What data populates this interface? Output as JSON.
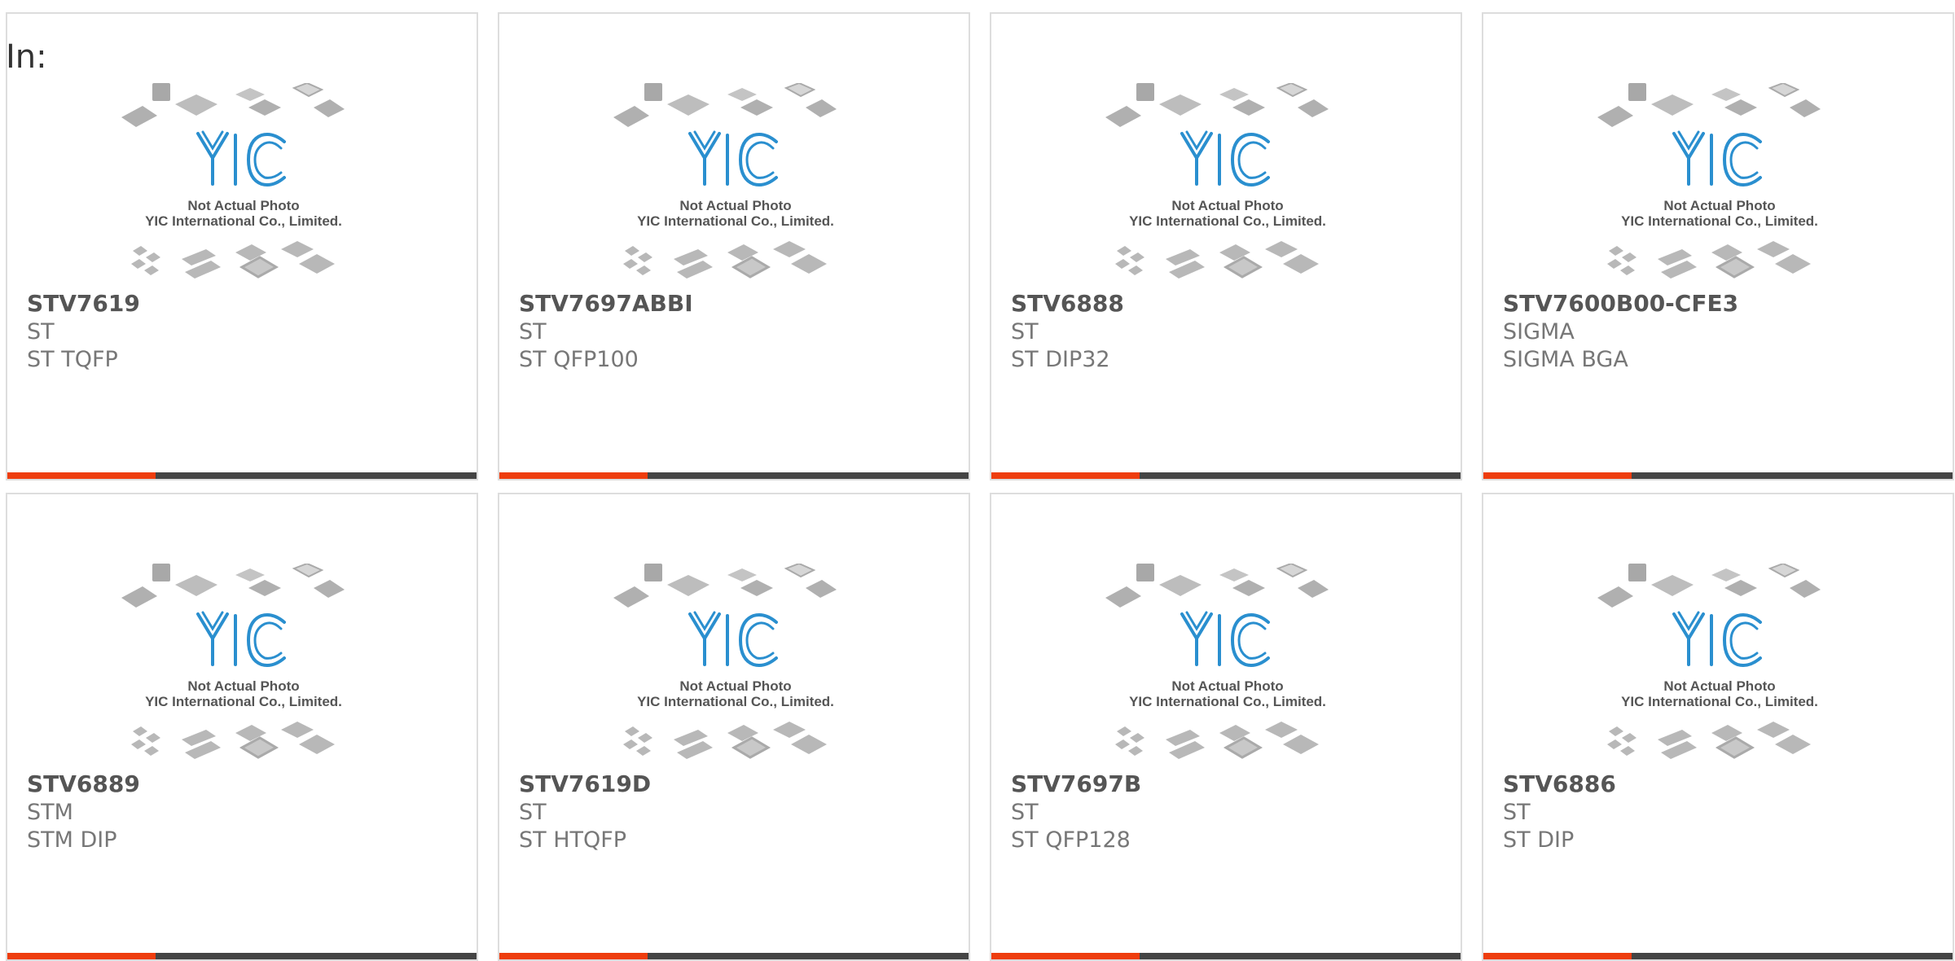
{
  "label_in": "In:",
  "colors": {
    "accent": "#ee3d0e",
    "bar_dark": "#444444",
    "logo_blue": "#2a8fcf",
    "chip_grey": "#b0b0b0"
  },
  "thumbnail": {
    "line1": "Not Actual Photo",
    "line2": "YIC International Co., Limited.",
    "logo_text": "YIC"
  },
  "products": [
    {
      "part": "STV7619",
      "maker": "ST",
      "package": "ST TQFP"
    },
    {
      "part": "STV7697ABBI",
      "maker": "ST",
      "package": "ST QFP100"
    },
    {
      "part": "STV6888",
      "maker": "ST",
      "package": "ST DIP32"
    },
    {
      "part": "STV7600B00-CFE3",
      "maker": "SIGMA",
      "package": "SIGMA BGA"
    },
    {
      "part": "STV6889",
      "maker": "STM",
      "package": "STM DIP"
    },
    {
      "part": "STV7619D",
      "maker": "ST",
      "package": "ST HTQFP"
    },
    {
      "part": "STV7697B",
      "maker": "ST",
      "package": "ST QFP128"
    },
    {
      "part": "STV6886",
      "maker": "ST",
      "package": "ST DIP"
    }
  ]
}
